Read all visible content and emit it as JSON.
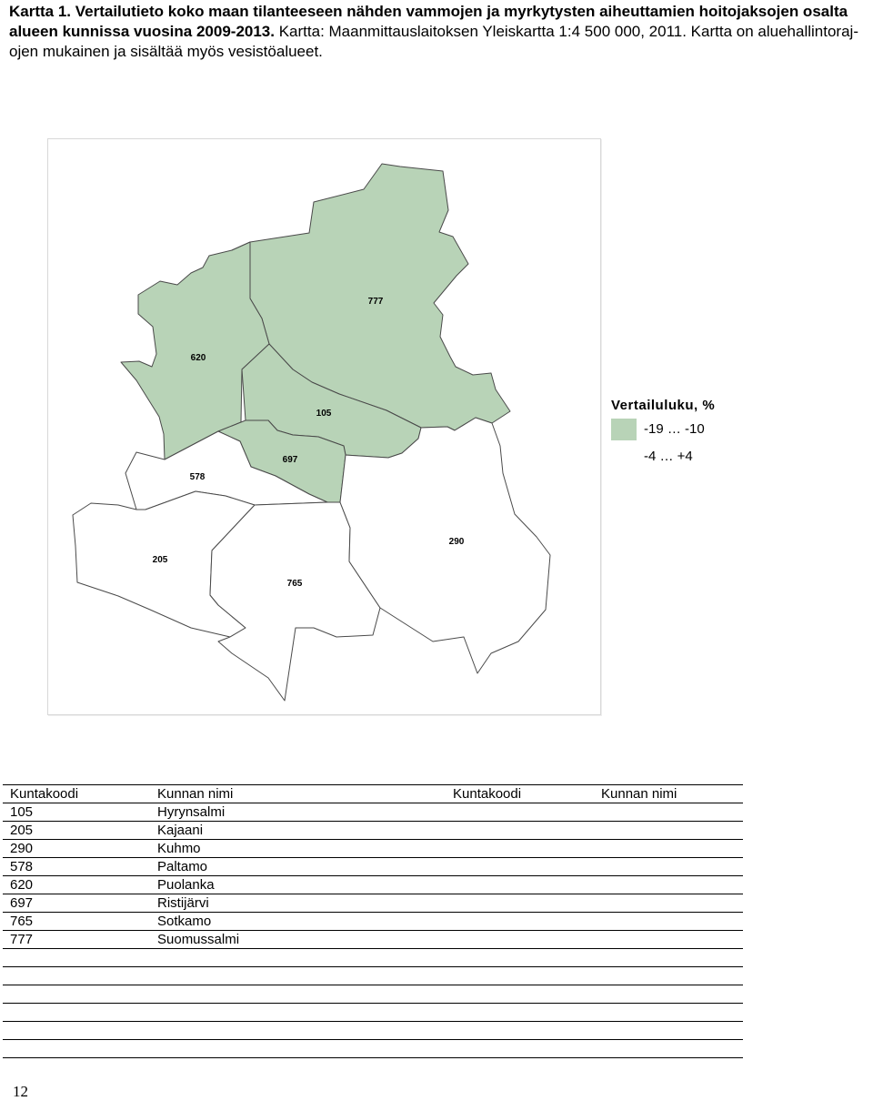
{
  "caption": {
    "bold_part": "Kartta 1. Vertailutieto koko maan tilanteeseen nähden vammojen ja myrkytysten aiheuttamien hoitojaksojen osalta alueen kunnissa vuosina 2009-2013.",
    "normal_part": " Kartta: Maanmittauslaitoksen Yleiskartta 1:4 500 000, 2011. Kartta on aluehallintoraj­ojen mukainen ja sisältää myös vesistöalueet."
  },
  "legend": {
    "title": "Vertailuluku, %",
    "items": [
      {
        "label": "-19 … -10",
        "color": "#b8d3b7"
      },
      {
        "label": "-4 … +4",
        "color": "#ffffff"
      }
    ]
  },
  "map": {
    "municipalities": [
      {
        "code": "777",
        "color": "#b8d3b7"
      },
      {
        "code": "620",
        "color": "#b8d3b7"
      },
      {
        "code": "105",
        "color": "#b8d3b7"
      },
      {
        "code": "697",
        "color": "#b8d3b7"
      },
      {
        "code": "578",
        "color": "#ffffff"
      },
      {
        "code": "205",
        "color": "#ffffff"
      },
      {
        "code": "765",
        "color": "#ffffff"
      },
      {
        "code": "290",
        "color": "#ffffff"
      }
    ]
  },
  "table": {
    "headers": [
      "Kuntakoodi",
      "Kunnan nimi",
      "Kuntakoodi",
      "Kunnan nimi"
    ],
    "rows": [
      [
        "105",
        "Hyrynsalmi",
        "",
        ""
      ],
      [
        "205",
        "Kajaani",
        "",
        ""
      ],
      [
        "290",
        "Kuhmo",
        "",
        ""
      ],
      [
        "578",
        "Paltamo",
        "",
        ""
      ],
      [
        "620",
        "Puolanka",
        "",
        ""
      ],
      [
        "697",
        "Ristijärvi",
        "",
        ""
      ],
      [
        "765",
        "Sotkamo",
        "",
        ""
      ],
      [
        "777",
        "Suomussalmi",
        "",
        ""
      ],
      [
        "",
        "",
        "",
        ""
      ],
      [
        "",
        "",
        "",
        ""
      ],
      [
        "",
        "",
        "",
        ""
      ],
      [
        "",
        "",
        "",
        ""
      ],
      [
        "",
        "",
        "",
        ""
      ],
      [
        "",
        "",
        "",
        ""
      ]
    ]
  },
  "page_number": "12"
}
